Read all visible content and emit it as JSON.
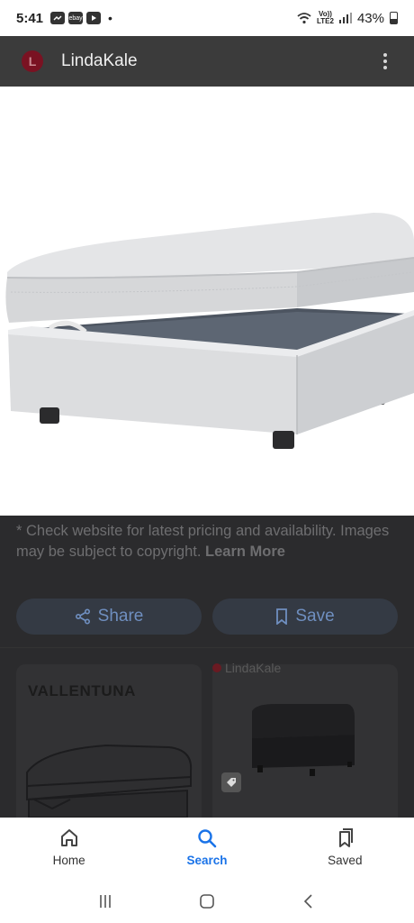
{
  "status_bar": {
    "time": "5:41",
    "notification_icons": [
      "messenger-icon",
      "ebay-icon",
      "youtube-icon"
    ],
    "ebay_label": "ebay",
    "volte_top": "Vo))",
    "volte_bottom": "LTE2",
    "battery": "43%"
  },
  "app_bar": {
    "site_name": "LindaKale",
    "logo_letter": "L"
  },
  "disclaimer": {
    "text": "* Check website for latest pricing and availability. Images may be subject to copyright. ",
    "link": "Learn More"
  },
  "actions": {
    "share_label": "Share",
    "save_label": "Save"
  },
  "related": {
    "card1_title": "VALLENTUNA",
    "card2_source": "LindaKale"
  },
  "bottom_nav": {
    "home": "Home",
    "search": "Search",
    "saved": "Saved",
    "active": "Search"
  },
  "colors": {
    "accent": "#1a73e8",
    "ottoman_fabric": "#d9dadc"
  }
}
